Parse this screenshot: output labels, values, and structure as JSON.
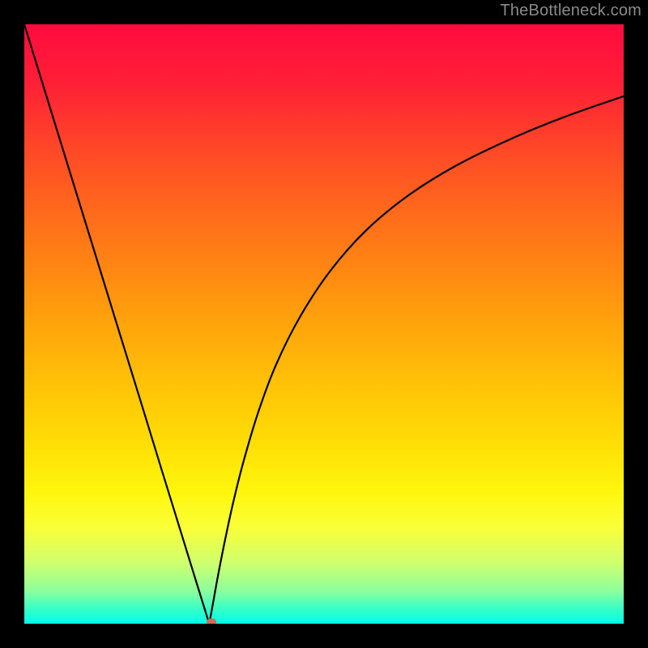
{
  "watermark": "TheBottleneck.com",
  "chart_data": {
    "type": "line",
    "title": "",
    "xlabel": "",
    "ylabel": "",
    "xlim": [
      0,
      1
    ],
    "ylim": [
      0,
      1
    ],
    "grid": false,
    "background_gradient_stops": [
      {
        "offset": 0.0,
        "color": "#ff0b3f"
      },
      {
        "offset": 0.1,
        "color": "#ff2036"
      },
      {
        "offset": 0.2,
        "color": "#ff4528"
      },
      {
        "offset": 0.3,
        "color": "#ff661d"
      },
      {
        "offset": 0.4,
        "color": "#ff8413"
      },
      {
        "offset": 0.5,
        "color": "#ffa40b"
      },
      {
        "offset": 0.6,
        "color": "#ffc207"
      },
      {
        "offset": 0.7,
        "color": "#ffde05"
      },
      {
        "offset": 0.78,
        "color": "#fff60d"
      },
      {
        "offset": 0.84,
        "color": "#f9ff38"
      },
      {
        "offset": 0.9,
        "color": "#ceff6f"
      },
      {
        "offset": 0.945,
        "color": "#8cff9c"
      },
      {
        "offset": 0.975,
        "color": "#38ffc6"
      },
      {
        "offset": 1.0,
        "color": "#00ffea"
      }
    ],
    "series": [
      {
        "name": "left-branch",
        "x": [
          0.0,
          0.05,
          0.1,
          0.15,
          0.2,
          0.23,
          0.26,
          0.285,
          0.302,
          0.3085
        ],
        "y": [
          1.0,
          0.838,
          0.676,
          0.514,
          0.352,
          0.254,
          0.157,
          0.076,
          0.021,
          0.0
        ]
      },
      {
        "name": "right-branch",
        "x": [
          0.3085,
          0.313,
          0.318,
          0.325,
          0.335,
          0.348,
          0.365,
          0.39,
          0.42,
          0.46,
          0.51,
          0.57,
          0.64,
          0.72,
          0.81,
          0.9,
          1.0
        ],
        "y": [
          0.0,
          0.024,
          0.052,
          0.09,
          0.14,
          0.2,
          0.268,
          0.352,
          0.432,
          0.512,
          0.588,
          0.656,
          0.714,
          0.764,
          0.808,
          0.845,
          0.88
        ]
      }
    ],
    "marker": {
      "x": 0.312,
      "y": 0.003,
      "color": "#d26a54"
    }
  }
}
